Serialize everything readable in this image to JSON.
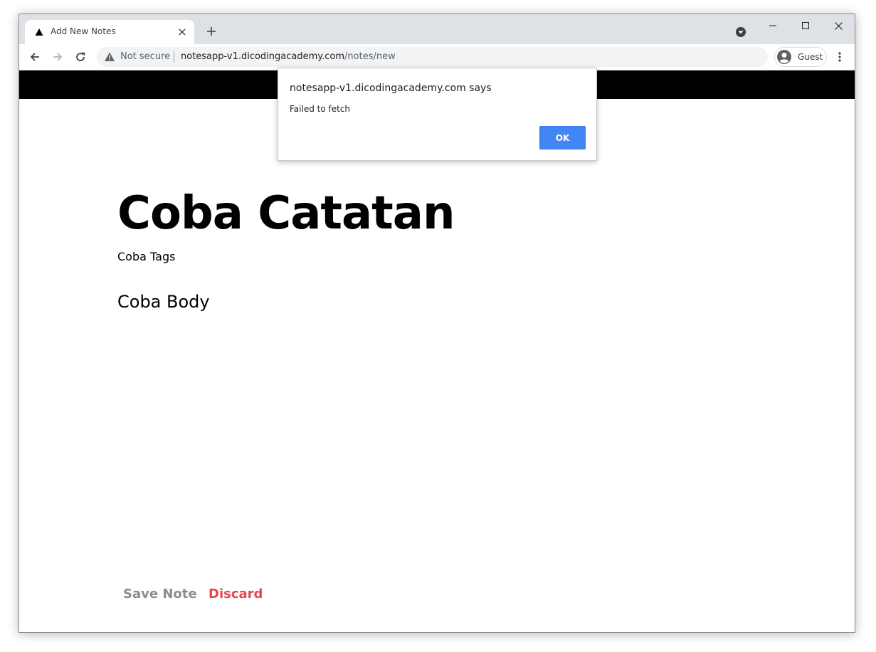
{
  "browser": {
    "tab": {
      "title": "Add New Notes"
    },
    "window_controls": {
      "minimize_icon": "minimize-icon",
      "maximize_icon": "maximize-icon",
      "close_icon": "close-icon"
    },
    "omnibox": {
      "security_label": "Not secure",
      "url_host": "notesapp-v1.dicodingacademy.com",
      "url_path": "/notes/new"
    },
    "profile": {
      "label": "Guest"
    }
  },
  "app": {
    "header_color": "#000000",
    "note": {
      "title": "Coba Catatan",
      "tags": "Coba Tags",
      "body": "Coba Body"
    },
    "actions": {
      "save_label": "Save Note",
      "discard_label": "Discard",
      "save_color": "#8c8c8c",
      "discard_color": "#e5484d"
    }
  },
  "alert": {
    "origin": "notesapp-v1.dicodingacademy.com says",
    "message": "Failed to fetch",
    "ok_label": "OK",
    "ok_color": "#4285f4"
  }
}
